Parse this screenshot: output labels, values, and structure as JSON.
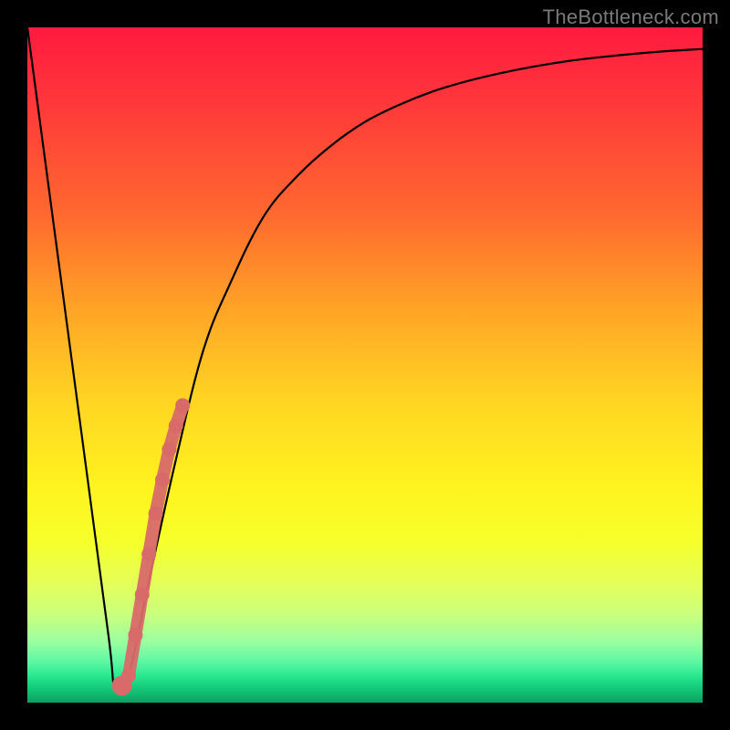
{
  "watermark": {
    "text": "TheBottleneck.com"
  },
  "colors": {
    "line": "#000000",
    "marker": "#d86a6a",
    "gradient_top": "#ff1a3f",
    "gradient_bottom": "#0e9f60",
    "frame": "#000000"
  },
  "chart_data": {
    "type": "line",
    "title": "",
    "xlabel": "",
    "ylabel": "",
    "xlim": [
      0,
      100
    ],
    "ylim": [
      0,
      100
    ],
    "grid": false,
    "series": [
      {
        "name": "curve",
        "x": [
          0,
          4,
          8,
          12,
          13,
          15,
          18,
          22,
          26,
          30,
          35,
          40,
          45,
          50,
          55,
          60,
          65,
          70,
          75,
          80,
          85,
          90,
          95,
          100
        ],
        "y": [
          100,
          70,
          40,
          10,
          2,
          4,
          18,
          36,
          52,
          62,
          72,
          78,
          82.5,
          86,
          88.5,
          90.5,
          92,
          93.2,
          94.2,
          95,
          95.6,
          96.1,
          96.5,
          96.8
        ]
      }
    ],
    "markers": {
      "name": "highlight-segment",
      "color": "#d86a6a",
      "x": [
        14,
        15,
        16,
        17,
        18,
        19,
        20,
        21,
        22,
        23
      ],
      "y": [
        2.5,
        4,
        10,
        16,
        22,
        28,
        33,
        37.5,
        41,
        44
      ]
    }
  }
}
